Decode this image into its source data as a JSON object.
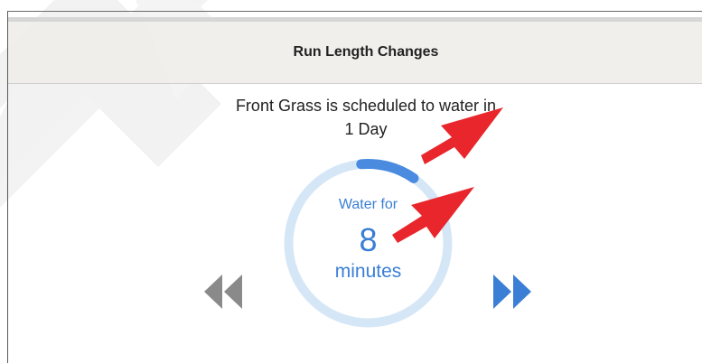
{
  "dialog": {
    "title": "Run Length Changes"
  },
  "schedule": {
    "line1": "Front Grass is scheduled to water in",
    "line2": "1 Day"
  },
  "dial": {
    "label": "Water for",
    "value": "8",
    "unit": "minutes"
  },
  "controls": {
    "decrease_icon": "rewind-icon",
    "increase_icon": "fast-forward-icon"
  },
  "colors": {
    "accent": "#4a8be0",
    "dial_track": "#d5e7f7",
    "annotation_arrow": "#e8262b",
    "disabled": "#8a8a8a"
  }
}
